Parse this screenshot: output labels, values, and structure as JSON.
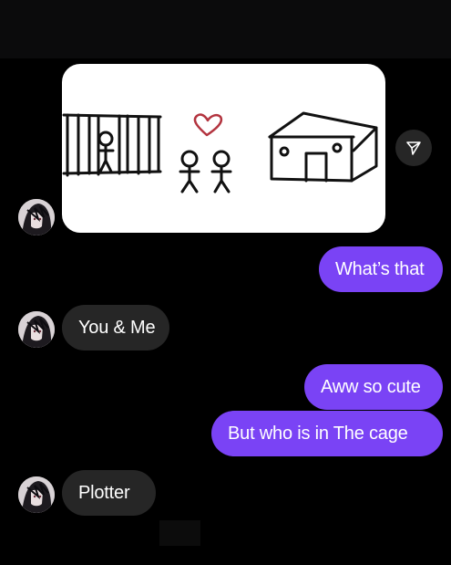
{
  "colors": {
    "background": "#000000",
    "outgoing_bubble": "#7a43f5",
    "incoming_bubble": "#262626",
    "text": "#ffffff"
  },
  "media": {
    "icon": "drawing-image",
    "description_icon": "share-icon"
  },
  "messages": [
    {
      "direction": "incoming",
      "type": "image",
      "avatar": "avatar-icon"
    },
    {
      "direction": "outgoing",
      "text": "What’s that"
    },
    {
      "direction": "incoming",
      "text": "You & Me",
      "avatar": "avatar-icon"
    },
    {
      "direction": "outgoing",
      "text": "Aww so cute"
    },
    {
      "direction": "outgoing",
      "text": "But who is in The cage"
    },
    {
      "direction": "incoming",
      "text": "Plotter",
      "avatar": "avatar-icon"
    }
  ]
}
